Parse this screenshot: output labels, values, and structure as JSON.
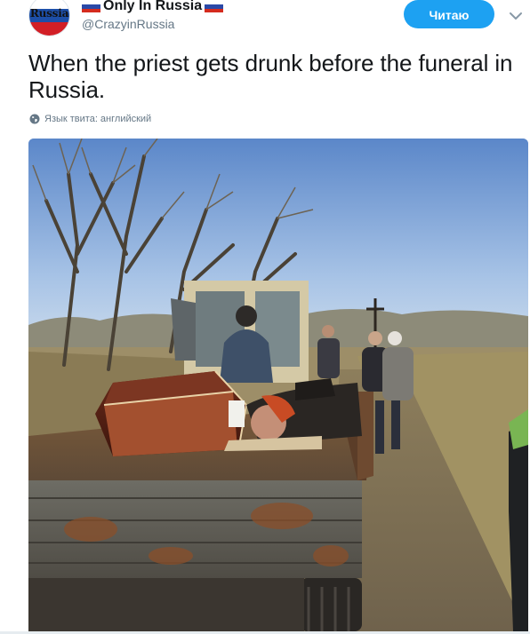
{
  "account": {
    "avatar_text": "Russia",
    "display_name": "Only In Russia",
    "handle": "@CrazyinRussia",
    "flag_icon": "russian-flag-icon"
  },
  "actions": {
    "follow_label": "Читаю",
    "menu_icon": "chevron-down-icon"
  },
  "tweet": {
    "text": "When the priest gets drunk before the funeral in Russia.",
    "language_note": "Язык твита: английский",
    "language_icon": "globe-icon"
  },
  "media": {
    "type": "photo",
    "scene": "coffin and man on the bed of a tractor trailer on a dirt road"
  },
  "colors": {
    "accent": "#1da1f2",
    "text": "#14171a",
    "secondary_text": "#657786"
  }
}
